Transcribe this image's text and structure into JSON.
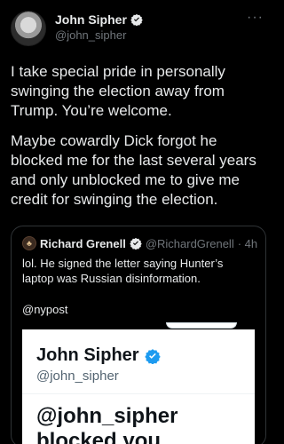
{
  "tweet": {
    "author_name": "John Sipher",
    "author_handle": "@john_sipher",
    "more_label": "···",
    "paragraphs": [
      "I take special pride in personally swinging the election away from Trump. You’re welcome.",
      "Maybe cowardly Dick forgot he blocked me for the last several years and only unblocked me to give me credit for swinging the election."
    ]
  },
  "quote": {
    "author_name": "Richard Grenell",
    "author_handle": "@RichardGrenell",
    "time": "· 4h",
    "text": "lol. He signed the letter saying Hunter’s laptop was Russian disinformation.",
    "source": "@nypost",
    "media": {
      "name": "John Sipher",
      "handle": "@john_sipher",
      "headline": "@john_sipher blocked you"
    }
  },
  "colors": {
    "background": "#000000",
    "text": "#e7e9ea",
    "muted": "#71767b",
    "verified": "#1d9bf0",
    "border": "#2f3336"
  }
}
